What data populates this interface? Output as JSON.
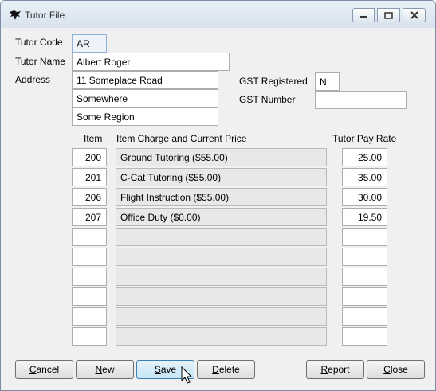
{
  "window": {
    "title": "Tutor File"
  },
  "form": {
    "tutor_code_label": "Tutor Code",
    "tutor_code": "AR",
    "tutor_name_label": "Tutor Name",
    "tutor_name": "Albert Roger",
    "address_label": "Address",
    "address_lines": [
      "11 Someplace Road",
      "Somewhere",
      "Some Region"
    ],
    "gst_registered_label": "GST Registered",
    "gst_registered": "N",
    "gst_number_label": "GST Number",
    "gst_number": ""
  },
  "table": {
    "headers": {
      "item": "Item",
      "charge": "Item Charge and Current Price",
      "pay_rate": "Tutor Pay Rate"
    },
    "rows": [
      {
        "item": "200",
        "charge": "Ground Tutoring   ($55.00)",
        "pay_rate": "25.00"
      },
      {
        "item": "201",
        "charge": "C-Cat Tutoring   ($55.00)",
        "pay_rate": "35.00"
      },
      {
        "item": "206",
        "charge": "Flight Instruction   ($55.00)",
        "pay_rate": "30.00"
      },
      {
        "item": "207",
        "charge": "Office Duty   ($0.00)",
        "pay_rate": "19.50"
      },
      {
        "item": "",
        "charge": "",
        "pay_rate": ""
      },
      {
        "item": "",
        "charge": "",
        "pay_rate": ""
      },
      {
        "item": "",
        "charge": "",
        "pay_rate": ""
      },
      {
        "item": "",
        "charge": "",
        "pay_rate": ""
      },
      {
        "item": "",
        "charge": "",
        "pay_rate": ""
      },
      {
        "item": "",
        "charge": "",
        "pay_rate": ""
      }
    ]
  },
  "buttons": {
    "cancel": "Cancel",
    "new": "New",
    "save": "Save",
    "delete": "Delete",
    "report": "Report",
    "close": "Close"
  }
}
